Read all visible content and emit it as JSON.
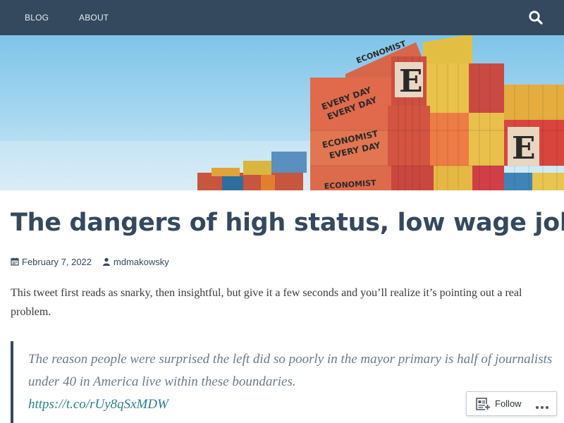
{
  "nav": {
    "items": [
      {
        "label": "BLOG"
      },
      {
        "label": "ABOUT"
      }
    ]
  },
  "header_image": {
    "container_text": [
      "ECONOMIST",
      "EVERY DAY",
      "ECONOMIST",
      "EVERY DAY",
      "ECONOMIST",
      "E"
    ]
  },
  "post": {
    "title": "The dangers of high status, low wage jobs",
    "date": "February 7, 2022",
    "author": "mdmakowsky",
    "intro": "This tweet first reads as snarky, then insightful, but give it a few seconds and you’ll realize it’s pointing out a real problem.",
    "quote": {
      "text": "The reason people were surprised the left did so poorly in the mayor primary is half of journalists under 40 in America live within these boundaries.",
      "link": "https://t.co/rUy8qSxMDW"
    }
  },
  "follow": {
    "label": "Follow"
  },
  "icons": {
    "search": "search-icon",
    "calendar": "calendar-icon",
    "user": "user-icon",
    "follow": "reader-follow-icon",
    "more": "more-horizontal-icon"
  },
  "colors": {
    "nav_bg": "#34495e",
    "title": "#34495e",
    "quote_text": "#6b7b8a",
    "link": "#2a7f8f"
  }
}
